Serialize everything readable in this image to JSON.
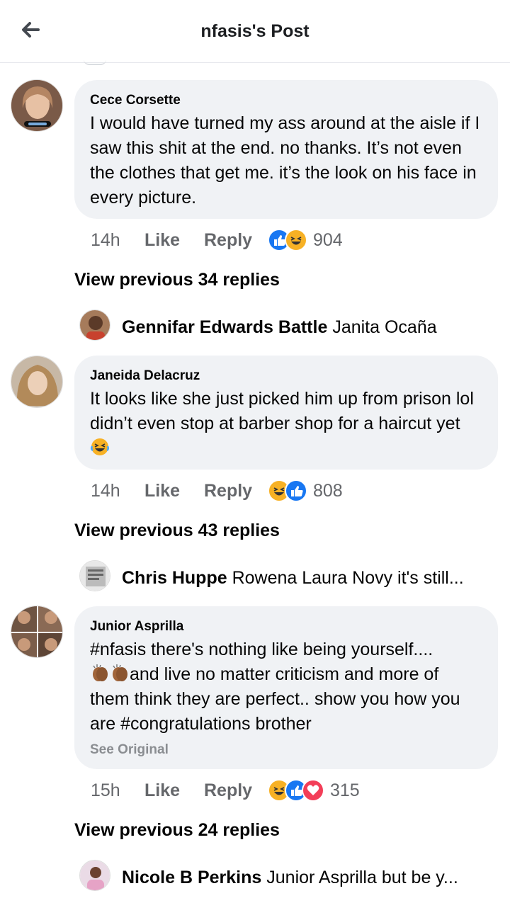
{
  "header": {
    "title": "nfasis's Post",
    "back_icon": "arrow-left-icon"
  },
  "comments": [
    {
      "author": "Cece Corsette",
      "text": "I would have turned my ass around at the aisle if I saw this shit at the end. no thanks. It’s not even the clothes that get me. it’s the look on his face in every picture.",
      "time": "14h",
      "like": "Like",
      "reply": "Reply",
      "reactions": [
        "like",
        "haha"
      ],
      "reaction_count": "904",
      "view_previous": "View previous 34 replies",
      "latest_reply": {
        "name": "Gennifar Edwards Battle",
        "text": "Janita Ocaña"
      }
    },
    {
      "author": "Janeida Delacruz",
      "text": "It looks like she just picked him up from prison lol didn’t even stop at barber shop for a haircut yet",
      "emoji": "tears-of-joy-emoji",
      "time": "14h",
      "like": "Like",
      "reply": "Reply",
      "reactions": [
        "haha",
        "like"
      ],
      "reaction_count": "808",
      "view_previous": "View previous 43 replies",
      "latest_reply": {
        "name": "Chris Huppe",
        "text": "Rowena Laura Novy it's still..."
      }
    },
    {
      "author": "Junior Asprilla",
      "text_line1": "#nfasis there's nothing like being yourself....",
      "text_rest": "and live no matter criticism and more of them think they are perfect.. show you how you are #congratulations brother",
      "see_original": "See Original",
      "time": "15h",
      "like": "Like",
      "reply": "Reply",
      "reactions": [
        "haha",
        "like",
        "love"
      ],
      "reaction_count": "315",
      "view_previous": "View previous 24 replies",
      "latest_reply": {
        "name": "Nicole B Perkins",
        "text": "Junior Asprilla but be y..."
      }
    }
  ],
  "colors": {
    "like_blue": "#1877f2",
    "haha_yellow": "#f7b125",
    "love_red": "#f33e58",
    "bubble_bg": "#f0f2f5",
    "meta_gray": "#65676b"
  }
}
